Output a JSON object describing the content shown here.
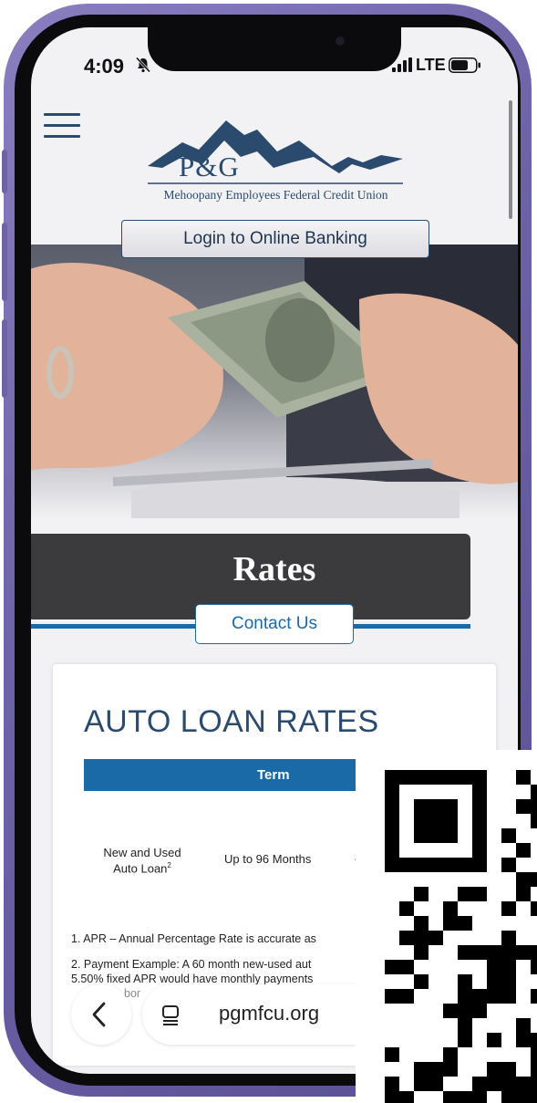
{
  "status_bar": {
    "time": "4:09",
    "network": "LTE"
  },
  "logo": {
    "abbr": "P&G",
    "subtitle": "Mehoopany Employees Federal Credit Union"
  },
  "header": {
    "login_label": "Login to Online Banking"
  },
  "banner": {
    "title": "Rates",
    "contact_label": "Contact Us"
  },
  "rates_card": {
    "heading": "AUTO LOAN RATES",
    "column_header": "Term",
    "row": {
      "product_line1": "New and Used",
      "product_line2": "Auto Loan",
      "product_sup": "2",
      "term": "Up to 96 Months"
    },
    "notes": [
      "1. APR – Annual Percentage Rate is accurate as",
      "2. Payment Example: A 60 month new-used aut",
      "5.50% fixed APR would have monthly payments",
      "bor"
    ]
  },
  "browser": {
    "url": "pgmfcu.org"
  },
  "colors": {
    "navy": "#2a4a6e",
    "accent_blue": "#1a6aa8",
    "banner_gray": "#3b3b3d",
    "frame_purple": "#6e63a8"
  },
  "icons": [
    "bell-slash-icon",
    "signal-icon",
    "battery-icon",
    "hamburger-menu-icon",
    "chevron-left-icon",
    "tabs-icon",
    "qr-code-icon"
  ]
}
